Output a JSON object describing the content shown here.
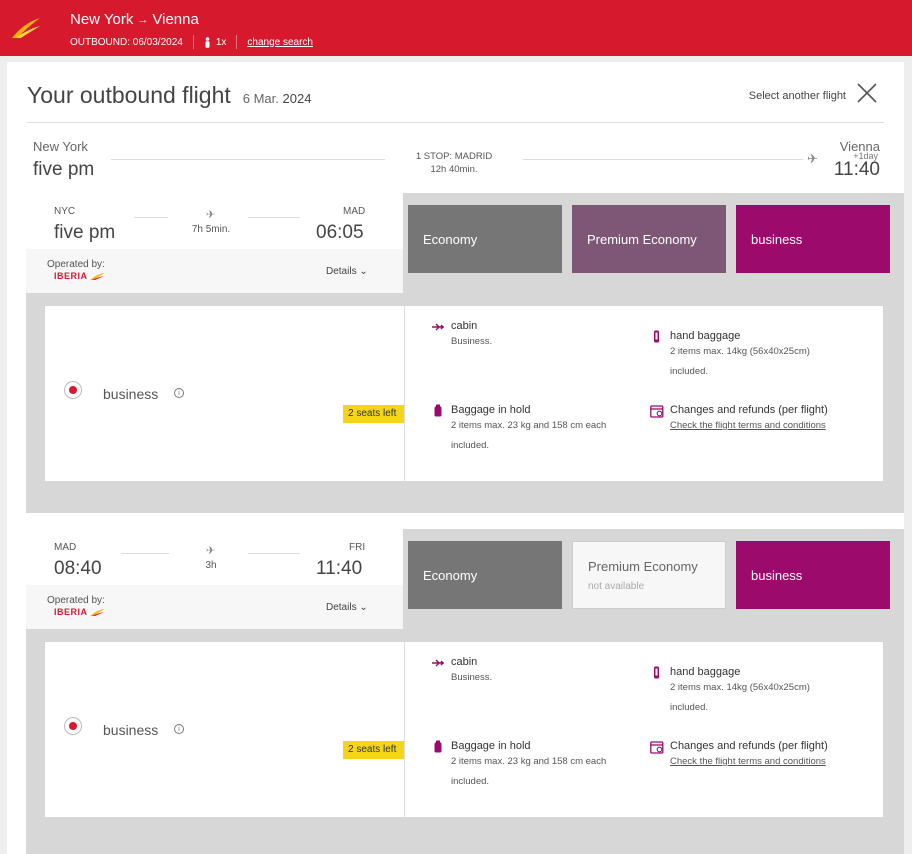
{
  "header": {
    "origin": "New York",
    "route_arrow": "→",
    "destination": "Vienna",
    "outbound_label": "OUTBOUND: 06/03/2024",
    "pax": "1x",
    "change_search": "change search"
  },
  "page": {
    "title": "Your outbound flight",
    "date_day": "6 Mar.",
    "date_year": "2024",
    "select_another": "Select another flight"
  },
  "summary": {
    "from_city": "New York",
    "from_time": "five pm",
    "stops": "1 STOP: MADRID",
    "duration": "12h 40min.",
    "to_city": "Vienna",
    "next_day": "+1day",
    "to_time": "11:40"
  },
  "segments": [
    {
      "from_code": "NYC",
      "from_time": "five pm",
      "duration": "7h 5min.",
      "to_code": "MAD",
      "to_time": "06:05",
      "operated_by": "Operated by:",
      "airline": "IBERIA",
      "details": "Details",
      "fares": {
        "economy": "Economy",
        "premium": "Premium Economy",
        "premium_note": "",
        "business": "business"
      },
      "selected_class": "business",
      "seats_left": "2 seats left",
      "features": {
        "cabin_title": "cabin",
        "cabin_desc": "Business.",
        "hand_title": "hand baggage",
        "hand_desc1": "2 items max. 14kg (56x40x25cm)",
        "hand_desc2": "included.",
        "hold_title": "Baggage in hold",
        "hold_desc1": "2 items max. 23 kg and 158 cm each",
        "hold_desc2": "included.",
        "changes_title": "Changes and refunds (per flight)",
        "changes_link": "Check the flight terms and conditions"
      }
    },
    {
      "from_code": "MAD",
      "from_time": "08:40",
      "duration": "3h",
      "to_code": "FRI",
      "to_time": "11:40",
      "operated_by": "Operated by:",
      "airline": "IBERIA",
      "details": "Details",
      "fares": {
        "economy": "Economy",
        "premium": "Premium Economy",
        "premium_note": "not available",
        "business": "business"
      },
      "selected_class": "business",
      "seats_left": "2 seats left",
      "features": {
        "cabin_title": "cabin",
        "cabin_desc": "Business.",
        "hand_title": "hand baggage",
        "hand_desc1": "2 items max. 14kg (56x40x25cm)",
        "hand_desc2": "included.",
        "hold_title": "Baggage in hold",
        "hold_desc1": "2 items max. 23 kg and 158 cm each",
        "hold_desc2": "included.",
        "changes_title": "Changes and refunds (per flight)",
        "changes_link": "Check the flight terms and conditions"
      }
    }
  ],
  "colors": {
    "brand_red": "#d7192d",
    "business": "#9c0a6c",
    "premium": "#7e5676",
    "economy": "#767676",
    "seats_badge": "#f5d519"
  },
  "icons": [
    "iberia-logo-icon",
    "person-icon",
    "close-icon",
    "plane-icon",
    "chevron-down-icon",
    "info-icon",
    "cabin-icon",
    "hand-baggage-icon",
    "suitcase-icon",
    "calendar-refund-icon"
  ]
}
